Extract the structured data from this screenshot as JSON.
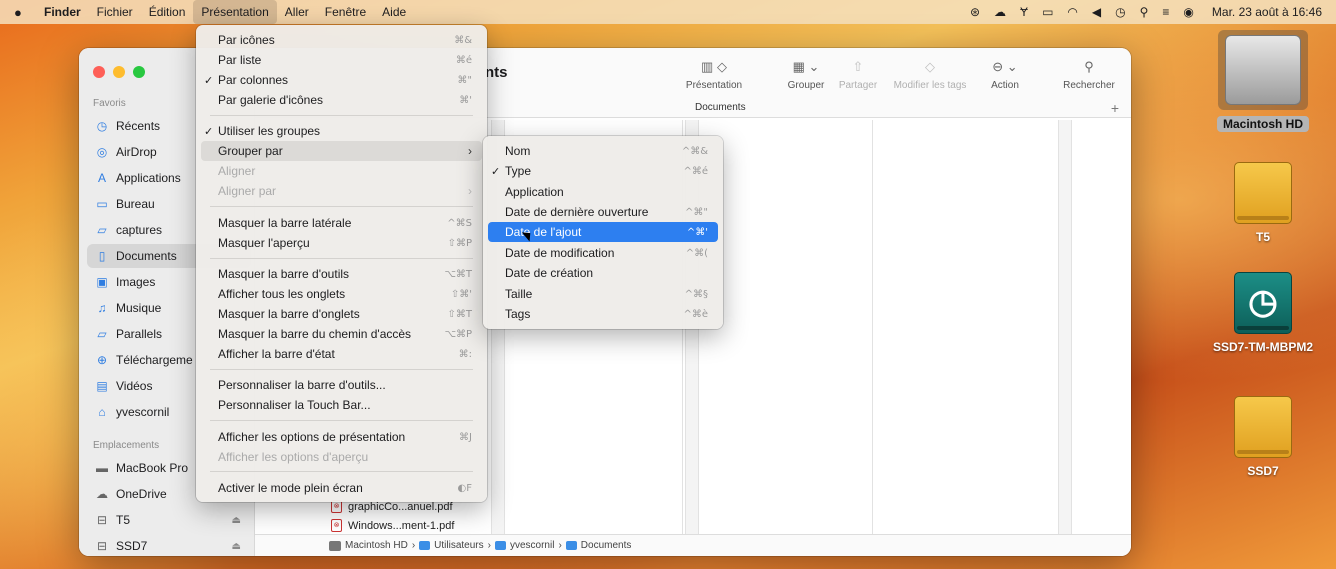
{
  "menubar": {
    "app": "Finder",
    "items": [
      "Fichier",
      "Édition",
      "Présentation",
      "Aller",
      "Fenêtre",
      "Aide"
    ],
    "clock": "Mar. 23 août à 16:46"
  },
  "finder": {
    "title_fragment": "nts",
    "sidebar": {
      "favoris_header": "Favoris",
      "favoris": [
        {
          "label": "Récents",
          "icon": "clock-icon"
        },
        {
          "label": "AirDrop",
          "icon": "airdrop-icon"
        },
        {
          "label": "Applications",
          "icon": "applications-icon"
        },
        {
          "label": "Bureau",
          "icon": "desktop-icon"
        },
        {
          "label": "captures",
          "icon": "folder-icon"
        },
        {
          "label": "Documents",
          "icon": "document-icon"
        },
        {
          "label": "Images",
          "icon": "image-icon"
        },
        {
          "label": "Musique",
          "icon": "music-icon"
        },
        {
          "label": "Parallels",
          "icon": "folder-icon"
        },
        {
          "label": "Téléchargeme",
          "icon": "download-icon"
        },
        {
          "label": "Vidéos",
          "icon": "video-icon"
        },
        {
          "label": "yvescornil",
          "icon": "home-icon"
        }
      ],
      "emplacements_header": "Emplacements",
      "emplacements": [
        {
          "label": "MacBook Pro",
          "icon": "laptop-icon"
        },
        {
          "label": "OneDrive",
          "icon": "cloud-icon"
        },
        {
          "label": "T5",
          "icon": "drive-icon"
        },
        {
          "label": "SSD7",
          "icon": "drive-icon"
        }
      ]
    },
    "toolbar": {
      "presentation": "Présentation",
      "grouper": "Grouper",
      "partager": "Partager",
      "modifier_tags": "Modifier les tags",
      "action": "Action",
      "rechercher": "Rechercher"
    },
    "tab": "Documents",
    "files": [
      "graphicCo...anuel.pdf",
      "Windows...ment-1.pdf"
    ],
    "path": [
      "Macintosh HD",
      "Utilisateurs",
      "yvescornil",
      "Documents"
    ]
  },
  "presentation_menu": {
    "items": [
      {
        "label": "Par icônes",
        "shortcut": "⌘&",
        "checked": false,
        "disabled": false
      },
      {
        "label": "Par liste",
        "shortcut": "⌘é",
        "checked": false,
        "disabled": false
      },
      {
        "label": "Par colonnes",
        "shortcut": "⌘\"",
        "checked": true,
        "disabled": false
      },
      {
        "label": "Par galerie d'icônes",
        "shortcut": "⌘'",
        "checked": false,
        "disabled": false
      },
      {
        "label": "Utiliser les groupes",
        "shortcut": "",
        "checked": true,
        "disabled": false
      },
      {
        "label": "Grouper par",
        "shortcut": "",
        "checked": false,
        "disabled": false,
        "submenu": true
      },
      {
        "label": "Aligner",
        "shortcut": "",
        "checked": false,
        "disabled": true
      },
      {
        "label": "Aligner par",
        "shortcut": "",
        "checked": false,
        "disabled": true,
        "submenu": true
      },
      {
        "label": "Masquer la barre latérale",
        "shortcut": "^⌘S",
        "checked": false,
        "disabled": false
      },
      {
        "label": "Masquer l'aperçu",
        "shortcut": "⇧⌘P",
        "checked": false,
        "disabled": false
      },
      {
        "label": "Masquer la barre d'outils",
        "shortcut": "⌥⌘T",
        "checked": false,
        "disabled": false
      },
      {
        "label": "Afficher tous les onglets",
        "shortcut": "⇧⌘'",
        "checked": false,
        "disabled": false
      },
      {
        "label": "Masquer la barre d'onglets",
        "shortcut": "⇧⌘T",
        "checked": false,
        "disabled": false
      },
      {
        "label": "Masquer la barre du chemin d'accès",
        "shortcut": "⌥⌘P",
        "checked": false,
        "disabled": false
      },
      {
        "label": "Afficher la barre d'état",
        "shortcut": "⌘:",
        "checked": false,
        "disabled": false
      },
      {
        "label": "Personnaliser la barre d'outils...",
        "shortcut": "",
        "checked": false,
        "disabled": false
      },
      {
        "label": "Personnaliser la Touch Bar...",
        "shortcut": "",
        "checked": false,
        "disabled": false
      },
      {
        "label": "Afficher les options de présentation",
        "shortcut": "⌘J",
        "checked": false,
        "disabled": false
      },
      {
        "label": "Afficher les options d'aperçu",
        "shortcut": "",
        "checked": false,
        "disabled": true
      },
      {
        "label": "Activer le mode plein écran",
        "shortcut": "◐F",
        "checked": false,
        "disabled": false
      }
    ]
  },
  "grouper_submenu": {
    "items": [
      {
        "label": "Nom",
        "shortcut": "^⌘&",
        "checked": false
      },
      {
        "label": "Type",
        "shortcut": "^⌘é",
        "checked": true
      },
      {
        "label": "Application",
        "shortcut": "",
        "checked": false
      },
      {
        "label": "Date de dernière ouverture",
        "shortcut": "^⌘\"",
        "checked": false
      },
      {
        "label": "Date de l'ajout",
        "shortcut": "^⌘'",
        "checked": false,
        "highlighted": true
      },
      {
        "label": "Date de modification",
        "shortcut": "^⌘(",
        "checked": false
      },
      {
        "label": "Date de création",
        "shortcut": "",
        "checked": false
      },
      {
        "label": "Taille",
        "shortcut": "^⌘§",
        "checked": false
      },
      {
        "label": "Tags",
        "shortcut": "^⌘è",
        "checked": false
      }
    ]
  },
  "desktop": {
    "icons": [
      {
        "label": "Macintosh HD",
        "type": "hard-drive-icon",
        "selected": true
      },
      {
        "label": "T5",
        "type": "external-drive-icon"
      },
      {
        "label": "SSD7-TM-MBPM2",
        "type": "time-machine-drive-icon"
      },
      {
        "label": "SSD7",
        "type": "external-drive-icon"
      }
    ]
  }
}
